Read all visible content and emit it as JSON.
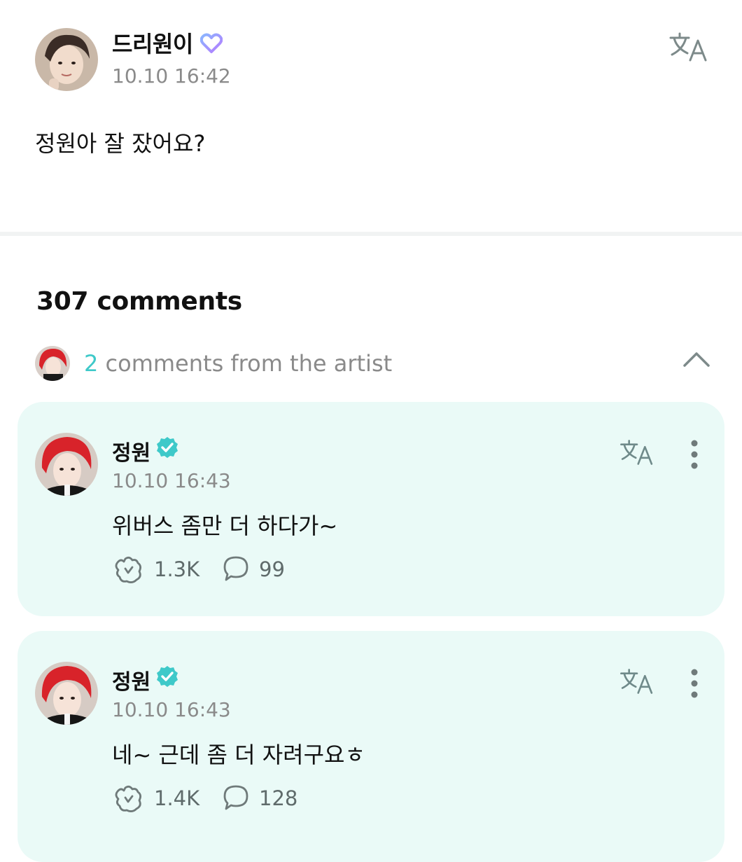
{
  "post": {
    "author": "드리원이",
    "time": "10.10 16:42",
    "body": "정원아 잘 잤어요?"
  },
  "comments_header": "307 comments",
  "artist_comments": {
    "count": "2",
    "label": "comments from the artist"
  },
  "comments": [
    {
      "author": "정원",
      "time": "10.10 16:43",
      "text": "위버스 좀만 더 하다가~",
      "likes": "1.3K",
      "replies": "99"
    },
    {
      "author": "정원",
      "time": "10.10 16:43",
      "text": "네~ 근데 좀 더 자려구요ㅎ",
      "likes": "1.4K",
      "replies": "128"
    }
  ],
  "icons": {
    "translate": "translate-icon",
    "fan-heart": "heart-badge-icon",
    "verified": "verified-check-icon",
    "chevron": "chevron-up-icon",
    "more": "more-vertical-icon",
    "like": "like-icon",
    "reply": "reply-bubble-icon"
  },
  "colors": {
    "accent": "#3ec9c9",
    "card_bg": "#eafaf7",
    "muted_text": "#8a8a8a"
  }
}
